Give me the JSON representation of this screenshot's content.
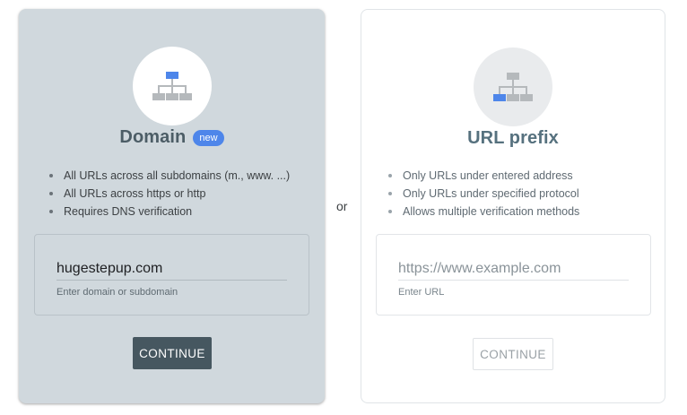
{
  "domain_card": {
    "title": "Domain",
    "badge": "new",
    "icon": "sitemap-icon",
    "bullets": [
      "All URLs across all subdomains (m., www. ...)",
      "All URLs across https or http",
      "Requires DNS verification"
    ],
    "input_value": "hugestepup.com",
    "input_hint": "Enter domain or subdomain",
    "button_label": "CONTINUE"
  },
  "separator": "or",
  "url_card": {
    "title": "URL prefix",
    "icon": "sitemap-icon",
    "bullets": [
      "Only URLs under entered address",
      "Only URLs under specified protocol",
      "Allows multiple verification methods"
    ],
    "input_placeholder": "https://www.example.com",
    "input_hint": "Enter URL",
    "button_label": "CONTINUE"
  },
  "colors": {
    "domain_card_bg": "#d0d8dd",
    "icon_selected": "#4e86ea",
    "icon_unselected": "#b5b9bc",
    "primary_button": "#465760",
    "badge": "#4e86ea"
  }
}
